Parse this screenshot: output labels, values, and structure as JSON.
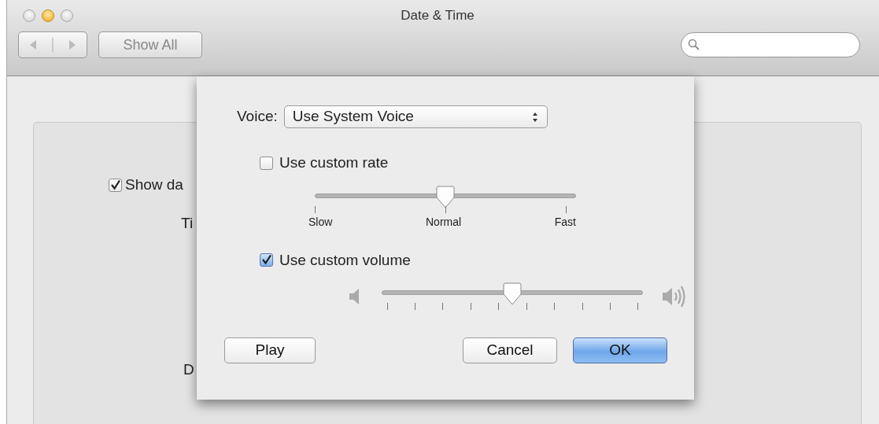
{
  "window": {
    "title": "Date & Time",
    "traffic_lights": [
      {
        "active": false
      },
      {
        "active": true
      },
      {
        "active": false
      }
    ]
  },
  "toolbar": {
    "show_all": "Show All"
  },
  "background": {
    "show_in_menu_bar": {
      "label": "Show da",
      "checked": true
    },
    "time_options_label": "Ti",
    "date_options_label": "D"
  },
  "sheet": {
    "voice": {
      "label": "Voice:",
      "value": "Use System Voice"
    },
    "rate": {
      "label": "Use custom rate",
      "checked": false,
      "level": 0.5,
      "scale_labels": [
        "Slow",
        "Normal",
        "Fast"
      ]
    },
    "volume": {
      "label": "Use custom volume",
      "checked": true,
      "level": 0.5
    },
    "buttons": [
      {
        "label": "Play",
        "default": false
      },
      {
        "label": "Cancel",
        "default": false
      },
      {
        "label": "OK",
        "default": true
      }
    ]
  }
}
